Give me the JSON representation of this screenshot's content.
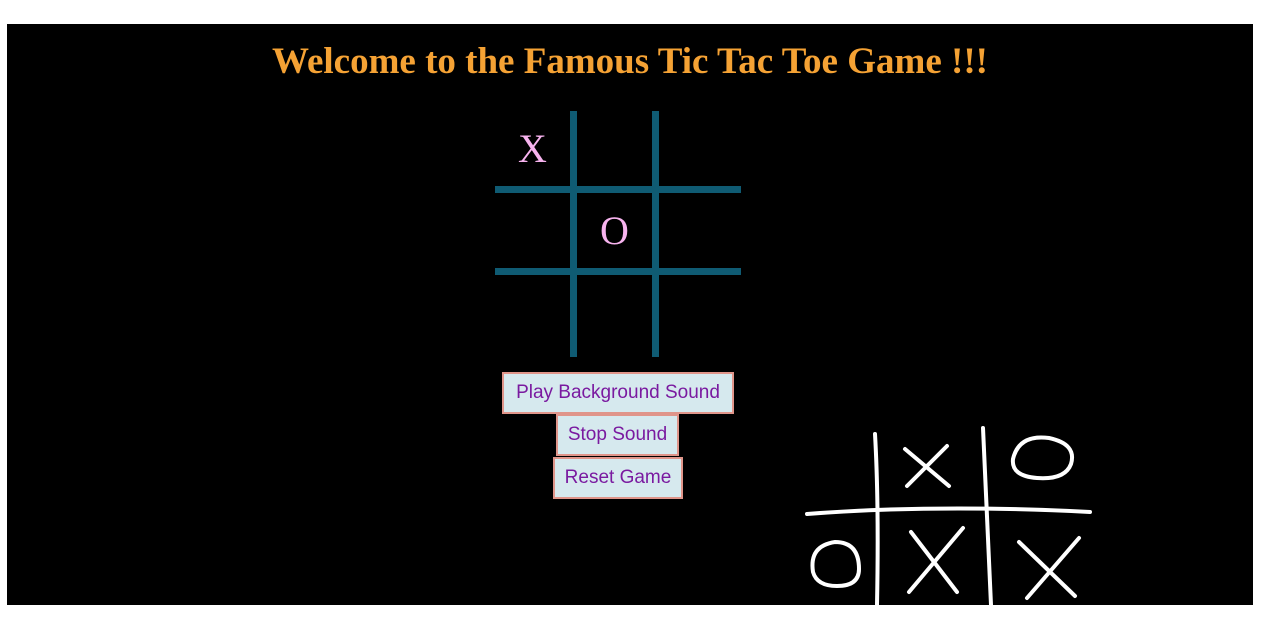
{
  "page": {
    "title": "Welcome to the Famous Tic Tac Toe Game !!!"
  },
  "board": {
    "cells": [
      "X",
      "",
      "",
      "",
      "O",
      "",
      "",
      "",
      ""
    ]
  },
  "buttons": {
    "play_sound": "Play Background Sound",
    "stop_sound": "Stop Sound",
    "reset_game": "Reset Game"
  },
  "colors": {
    "background": "#000000",
    "title": "#f5a234",
    "grid_lines": "#0f5b73",
    "marks": "#f7b3ee",
    "button_bg": "#d6e9ee",
    "button_text": "#7a1aa0",
    "button_border": "#e0958a",
    "decoration": "#ffffff"
  },
  "decoration": {
    "icon": "chalk-tic-tac-toe-illustration"
  }
}
